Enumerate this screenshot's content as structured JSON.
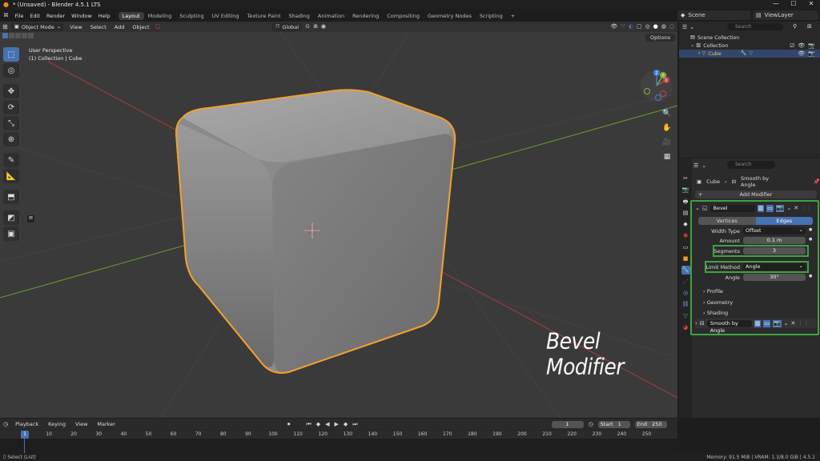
{
  "window": {
    "title": "* (Unsaved) - Blender 4.5.1 LTS",
    "minimize": "—",
    "maximize": "☐",
    "close": "✕"
  },
  "menu": [
    "File",
    "Edit",
    "Render",
    "Window",
    "Help"
  ],
  "workspaces": [
    "Layout",
    "Modeling",
    "Sculpting",
    "UV Editing",
    "Texture Paint",
    "Shading",
    "Animation",
    "Rendering",
    "Compositing",
    "Geometry Nodes",
    "Scripting"
  ],
  "workspace_add": "+",
  "scene": {
    "label": "Scene",
    "viewlayer": "ViewLayer"
  },
  "viewport": {
    "mode": "Object Mode",
    "menus": [
      "View",
      "Select",
      "Add",
      "Object"
    ],
    "transform_orientation": "Global",
    "options": "Options",
    "info_line1": "User Perspective",
    "info_line2": "(1) Collection | Cube",
    "gizmo_axes": [
      "X",
      "Y",
      "Z"
    ]
  },
  "outliner": {
    "search_placeholder": "Search",
    "rows": [
      {
        "label": "Scene Collection"
      },
      {
        "label": "Collection"
      },
      {
        "label": "Cube"
      }
    ]
  },
  "properties": {
    "search_placeholder": "Search",
    "breadcrumb_object": "Cube",
    "breadcrumb_sep": "›",
    "breadcrumb_modifier": "Smooth by Angle",
    "add_modifier": "Add Modifier",
    "add_icon": "+",
    "bevel": {
      "name": "Bevel",
      "tab_vertices": "Vertices",
      "tab_edges": "Edges",
      "width_type_label": "Width Type",
      "width_type_value": "Offset",
      "amount_label": "Amount",
      "amount_value": "0.1 m",
      "segments_label": "Segments",
      "segments_value": "3",
      "limit_label": "Limit Method",
      "limit_value": "Angle",
      "angle_label": "Angle",
      "angle_value": "30°",
      "panels": [
        "Profile",
        "Geometry",
        "Shading"
      ]
    },
    "smooth": {
      "name": "Smooth by Angle"
    }
  },
  "timeline": {
    "playback": "Playback",
    "keying": "Keying",
    "view": "View",
    "marker": "Marker",
    "current_frame": "1",
    "start_label": "Start",
    "start_value": "1",
    "end_label": "End",
    "end_value": "250",
    "ticks": [
      "10",
      "20",
      "30",
      "40",
      "50",
      "60",
      "70",
      "80",
      "90",
      "100",
      "110",
      "120",
      "130",
      "140",
      "150",
      "160",
      "170",
      "180",
      "190",
      "200",
      "210",
      "220",
      "230",
      "240",
      "250"
    ],
    "playhead": "1"
  },
  "status": {
    "left": "Select (List)",
    "right": "Memory: 91.5 MiB | VRAM: 1.3/8.0 GiB | 4.5.1"
  },
  "overlay_text": "Bevel Modifier",
  "colors": {
    "accent": "#4772b3",
    "highlight_box": "#3fa33f",
    "selection_outline": "#f0a030",
    "x_axis": "#c8404a",
    "y_axis": "#7fb13a",
    "z_axis": "#3c7fd6"
  }
}
